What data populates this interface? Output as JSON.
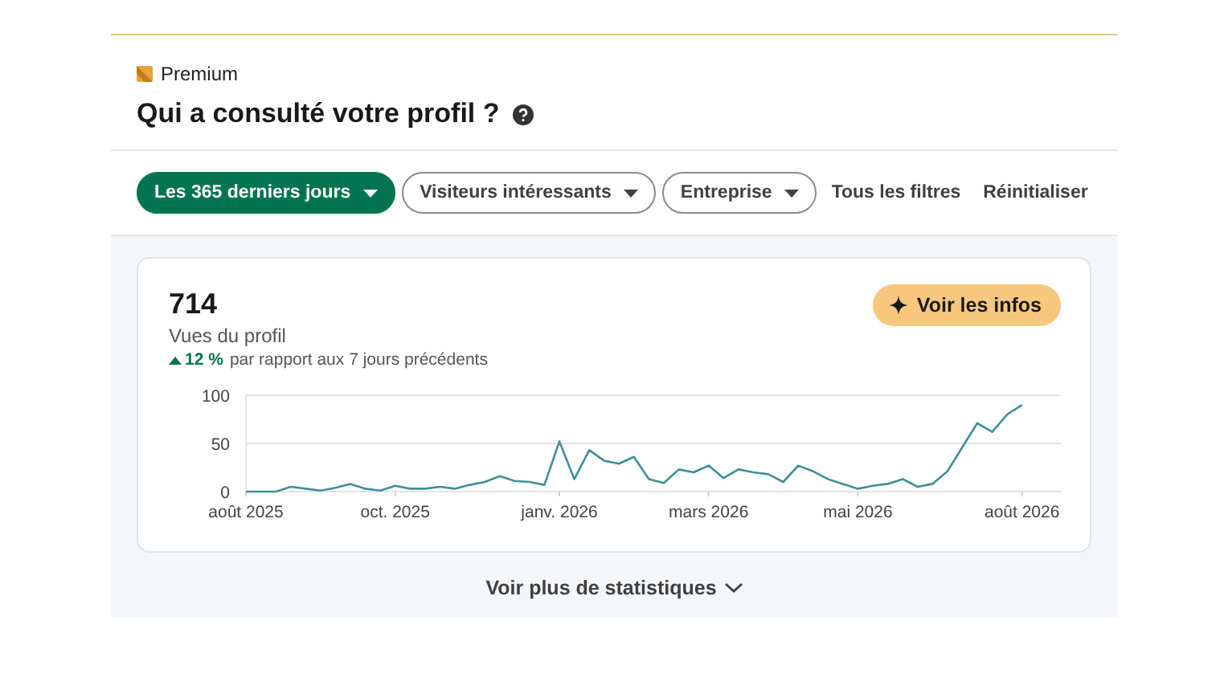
{
  "premium": {
    "label": "Premium"
  },
  "title": "Qui a consulté votre profil ?",
  "filters": [
    {
      "label": "Les 365 derniers jours",
      "kind": "dropdown",
      "selected": true
    },
    {
      "label": "Visiteurs intéressants",
      "kind": "dropdown",
      "selected": false
    },
    {
      "label": "Entreprise",
      "kind": "dropdown",
      "selected": false
    },
    {
      "label": "Tous les filtres",
      "kind": "link",
      "selected": false
    },
    {
      "label": "Réinitialiser",
      "kind": "link",
      "selected": false
    }
  ],
  "stats": {
    "value": "714",
    "label": "Vues du profil",
    "change": "12 %",
    "change_text": "par rapport aux 7 jours précédents",
    "insights_button": "Voir les infos",
    "chart_data": {
      "type": "line",
      "categories": [
        "août 2025",
        null,
        null,
        null,
        null,
        null,
        null,
        null,
        null,
        null,
        "oct. 2025",
        null,
        null,
        null,
        null,
        null,
        null,
        null,
        null,
        null,
        null,
        "janv. 2026",
        null,
        null,
        null,
        null,
        null,
        null,
        null,
        null,
        null,
        "mars 2026",
        null,
        null,
        null,
        null,
        null,
        null,
        null,
        null,
        null,
        "mai 2026",
        null,
        null,
        null,
        null,
        null,
        null,
        null,
        null,
        null,
        null,
        "août 2026"
      ],
      "series": [
        {
          "color": "#3f8f98",
          "values": [
            0,
            0,
            0,
            5,
            3,
            1,
            4,
            8,
            3,
            1,
            6,
            3,
            3,
            5,
            3,
            7,
            10,
            16,
            11,
            10,
            7,
            52,
            13,
            43,
            32,
            29,
            36,
            13,
            9,
            23,
            20,
            27,
            14,
            23,
            20,
            18,
            10,
            27,
            21,
            13,
            8,
            3,
            6,
            8,
            13,
            5,
            8,
            21,
            46,
            71,
            62,
            80,
            90
          ]
        }
      ],
      "ylim": [
        0,
        100
      ],
      "yticks": [
        0,
        50,
        100
      ]
    }
  },
  "more_link": "Voir plus de statistiques"
}
